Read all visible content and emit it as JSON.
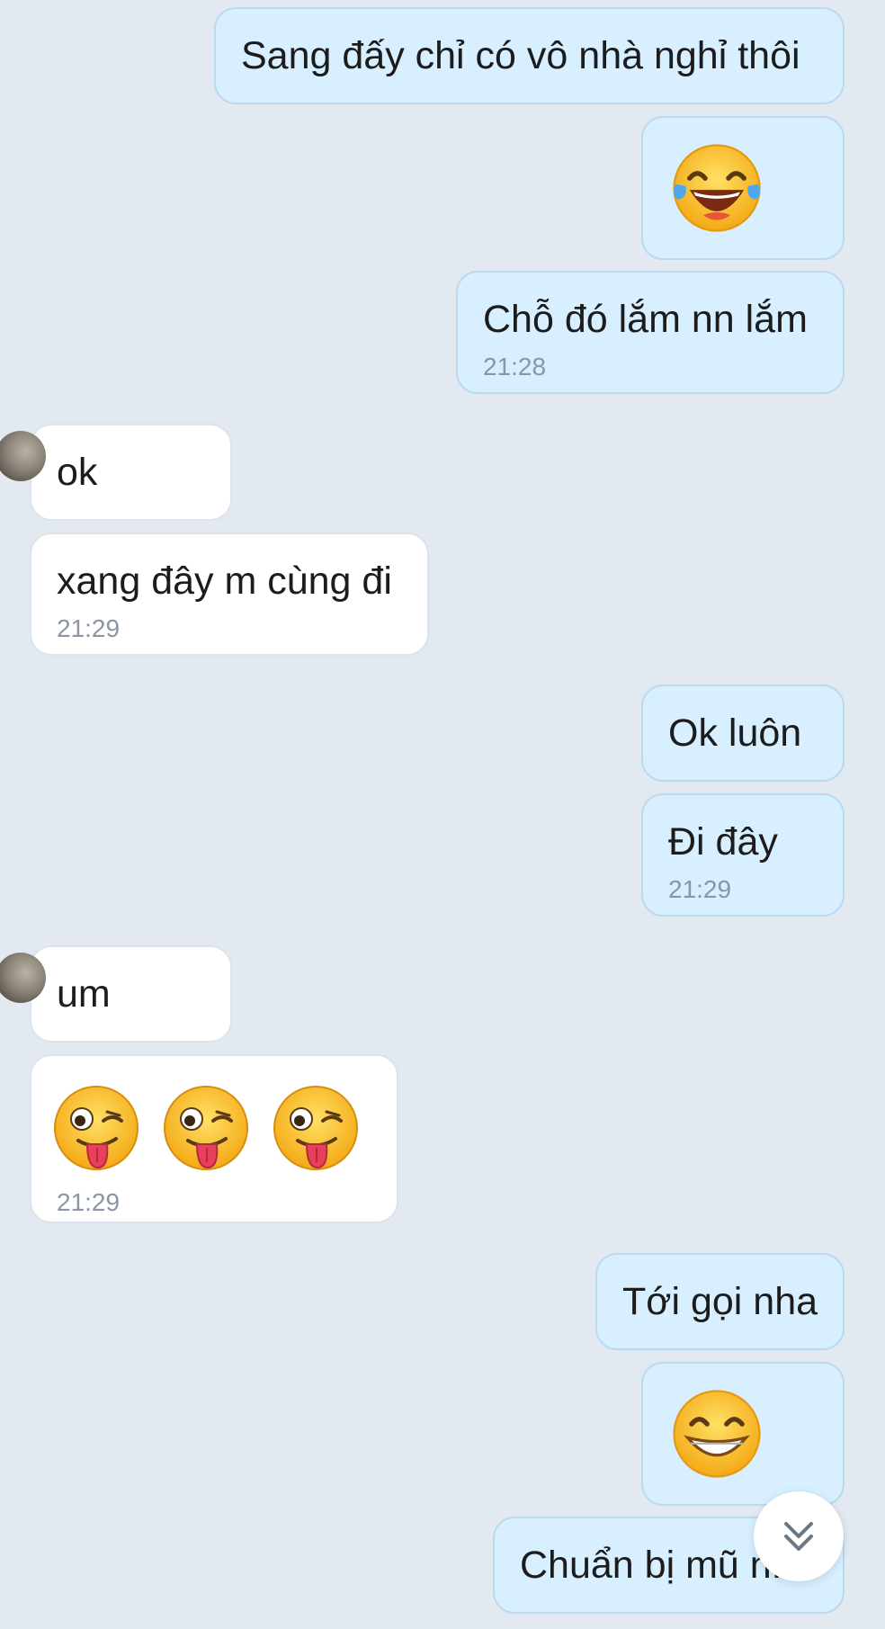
{
  "messages": [
    {
      "text": "Sang đấy chỉ có vô nhà nghỉ thôi"
    },
    {
      "emoji": "tears-of-joy-face"
    },
    {
      "text": "Chỗ đó lắm nn lắm",
      "time": "21:28"
    },
    {
      "text": "ok"
    },
    {
      "text": "xang đây m cùng đi",
      "time": "21:29"
    },
    {
      "text": "Ok luôn"
    },
    {
      "text": "Đi đây",
      "time": "21:29"
    },
    {
      "text": "um"
    },
    {
      "emoji": "winking-tongue-face",
      "time": "21:29"
    },
    {
      "text": "Tới gọi nha"
    },
    {
      "emoji": "grinning-face"
    },
    {
      "text": "Chuẩn bị mũ n..."
    }
  ],
  "scroll_button_icon": "double-chevron-down-icon"
}
